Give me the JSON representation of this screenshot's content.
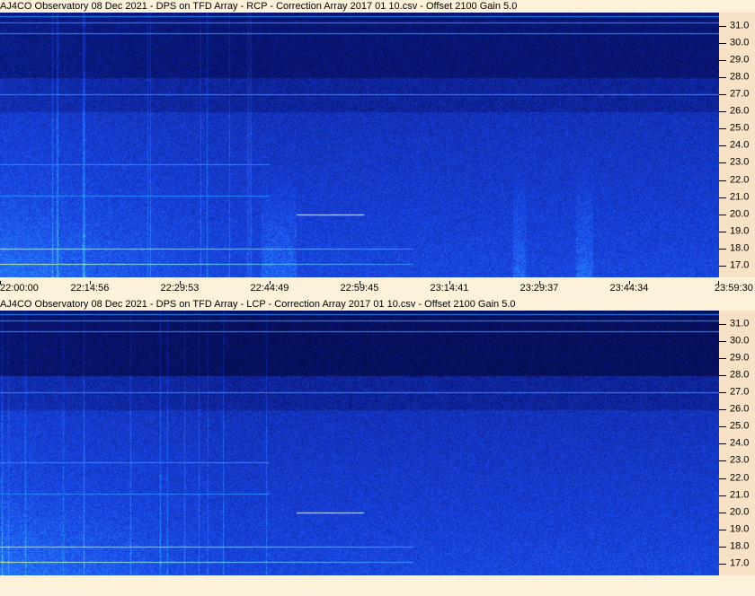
{
  "chart_data": [
    {
      "type": "heatmap",
      "title": "AJ4CO Observatory 08 Dec 2021  -  DPS on TFD Array  -  RCP  -  Correction Array 2017 01 10.csv  -  Offset 2100  Gain 5.0",
      "y_ticks": [
        "31.0",
        "30.0",
        "29.0",
        "28.0",
        "27.0",
        "26.0",
        "25.0",
        "24.0",
        "23.0",
        "22.0",
        "21.0",
        "20.0",
        "19.0",
        "18.0",
        "17.0"
      ],
      "x_ticks": [
        "22:00:00",
        "22:14:56",
        "22:29:53",
        "22:44:49",
        "22:59:45",
        "23:14:41",
        "23:29:37",
        "23:44:34",
        "23:59:30"
      ],
      "ylim": [
        16.3,
        31.8
      ]
    },
    {
      "type": "heatmap",
      "title": "AJ4CO Observatory 08 Dec 2021  -  DPS on TFD Array  -  LCP  -  Correction Array 2017 01 10.csv  -  Offset 2100  Gain 5.0",
      "y_ticks": [
        "31.0",
        "30.0",
        "29.0",
        "28.0",
        "27.0",
        "26.0",
        "25.0",
        "24.0",
        "23.0",
        "22.0",
        "21.0",
        "20.0",
        "19.0",
        "18.0",
        "17.0"
      ],
      "ylim": [
        16.3,
        31.8
      ]
    }
  ]
}
